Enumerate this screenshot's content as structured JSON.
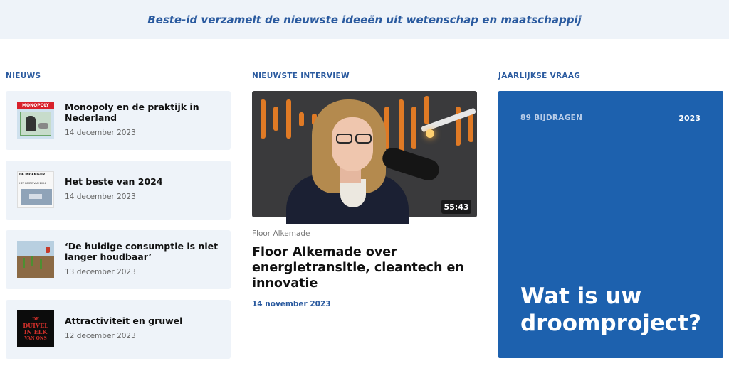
{
  "banner": {
    "text": "Beste-id verzamelt de nieuwste ideeën uit wetenschap en maatschappij"
  },
  "news": {
    "label": "NIEUWS",
    "items": [
      {
        "title": "Monopoly en de praktijk in Nederland",
        "date": "14 december 2023",
        "thumb_text": "MONOPOLY"
      },
      {
        "title": "Het beste van 2024",
        "date": "14 december 2023",
        "thumb_text": "DE INGENIEUR",
        "thumb_sub": "HET BESTE VAN 2024"
      },
      {
        "title": "‘De huidige consumptie is niet langer houdbaar’",
        "date": "13 december 2023"
      },
      {
        "title": "Attractiviteit en gruwel",
        "date": "12 december 2023",
        "thumb_lines": [
          "DE",
          "DUIVEL",
          "IN ELK",
          "VAN ONS"
        ]
      }
    ]
  },
  "interview": {
    "label": "NIEUWSTE INTERVIEW",
    "duration": "55:43",
    "person": "Floor Alkemade",
    "title": "Floor Alkemade over energietransitie, cleantech en innovatie",
    "date": "14 november 2023"
  },
  "question": {
    "label": "JAARLIJKSE VRAAG",
    "count": "89 BIJDRAGEN",
    "year": "2023",
    "title": "Wat is uw droomproject?"
  },
  "colors": {
    "accent": "#2a5a9f",
    "card_bg": "#eef3f9",
    "question_bg": "#1d61ae"
  }
}
